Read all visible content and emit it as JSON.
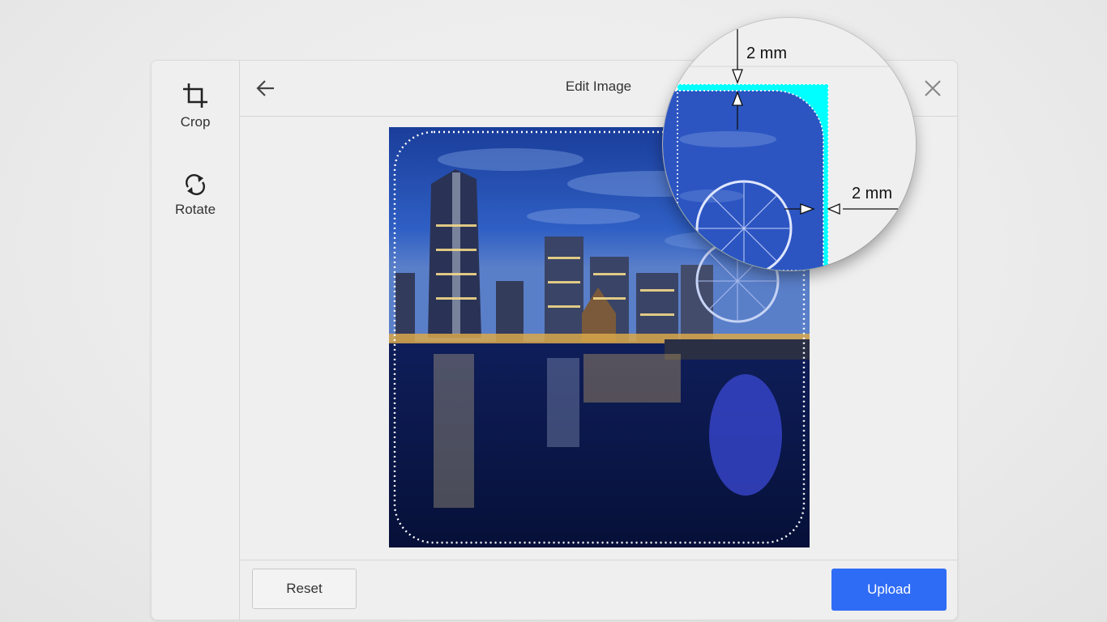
{
  "dialog": {
    "title": "Edit Image",
    "back_icon": "arrow-left-icon",
    "close_icon": "close-icon"
  },
  "sidebar": {
    "items": [
      {
        "label": "Crop",
        "icon": "crop-icon"
      },
      {
        "label": "Rotate",
        "icon": "rotate-icon"
      }
    ]
  },
  "footer": {
    "reset_label": "Reset",
    "upload_label": "Upload"
  },
  "magnifier": {
    "top_margin_label": "2 mm",
    "right_margin_label": "2 mm"
  },
  "colors": {
    "accent": "#2f6cf6",
    "bleed": "#00ffff"
  }
}
